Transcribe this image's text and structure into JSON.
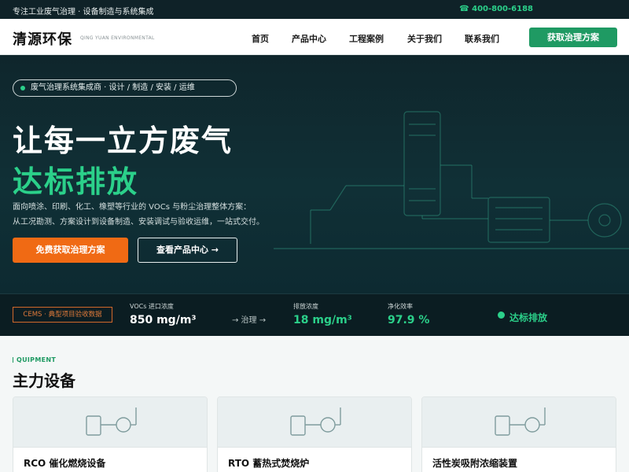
{
  "topbar": {
    "tagline": "专注工业废气治理 · 设备制造与系统集成",
    "phone": "☎ 400-800-6188"
  },
  "nav": {
    "logo": "清源环保",
    "logo_en": "QING YUAN ENVIRONMENTAL",
    "items": [
      {
        "label": "首页"
      },
      {
        "label": "产品中心"
      },
      {
        "label": "工程案例"
      },
      {
        "label": "关于我们"
      },
      {
        "label": "联系我们"
      }
    ],
    "cta": "获取治理方案"
  },
  "hero": {
    "badge": "废气治理系统集成商 · 设计 / 制造 / 安装 / 运维",
    "title_line1": "让每一立方废气",
    "title_line2": "达标排放",
    "desc_line1": "面向喷涂、印刷、化工、橡塑等行业的 VOCs 与粉尘治理整体方案：",
    "desc_line2": "从工况勘测、方案设计到设备制造、安装调试与验收运维，一站式交付。",
    "btn_primary": "免费获取治理方案",
    "btn_secondary": "查看产品中心 →"
  },
  "stats": {
    "badge": "CEMS · 典型项目验收数据",
    "inlet_label": "VOCs 进口浓度",
    "inlet_value": "850 mg/m³",
    "arrow": "→ 治理 →",
    "outlet_label": "排放浓度",
    "outlet_value": "18 mg/m³",
    "eff_label": "净化效率",
    "eff_value": "97.9 %",
    "status": "达标排放"
  },
  "equipment": {
    "tag": "QUIPMENT",
    "title": "主力设备",
    "cards": [
      {
        "name": "RCO 催化燃烧设备"
      },
      {
        "name": "RTO 蓄热式焚烧炉"
      },
      {
        "name": "活性炭吸附浓缩装置"
      }
    ]
  },
  "colors": {
    "accent_green": "#2bd08a",
    "button_green": "#1f9a63",
    "accent_orange": "#f06a14",
    "hero_bg": "#103036"
  }
}
